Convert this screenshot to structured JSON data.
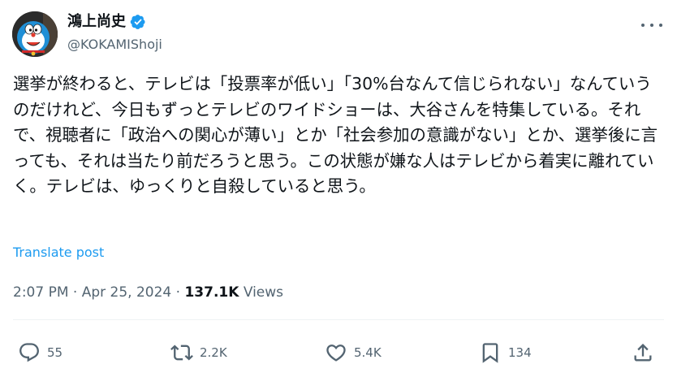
{
  "author": {
    "display_name": "鴻上尚史",
    "handle": "@KOKAMIShoji",
    "verified": true,
    "badge_color": "#1d9bf0"
  },
  "post": {
    "text": "選挙が終わると、テレビは「投票率が低い」「30%台なんて信じられない」なんていうのだけれど、今日もずっとテレビのワイドショーは、大谷さんを特集している。それで、視聴者に「政治への関心が薄い」とか「社会参加の意識がない」とか、選挙後に言っても、それは当たり前だろうと思う。この状態が嫌な人はテレビから着実に離れていく。テレビは、ゆっくりと自殺していると思う。",
    "translate_label": "Translate post"
  },
  "meta": {
    "time": "2:07 PM",
    "separator": "·",
    "date": "Apr 25, 2024",
    "views_count": "137.1K",
    "views_label": "Views"
  },
  "actions": {
    "replies": "55",
    "reposts": "2.2K",
    "likes": "5.4K",
    "bookmarks": "134"
  },
  "colors": {
    "text": "#0f1419",
    "muted": "#536471",
    "link": "#1d9bf0"
  }
}
